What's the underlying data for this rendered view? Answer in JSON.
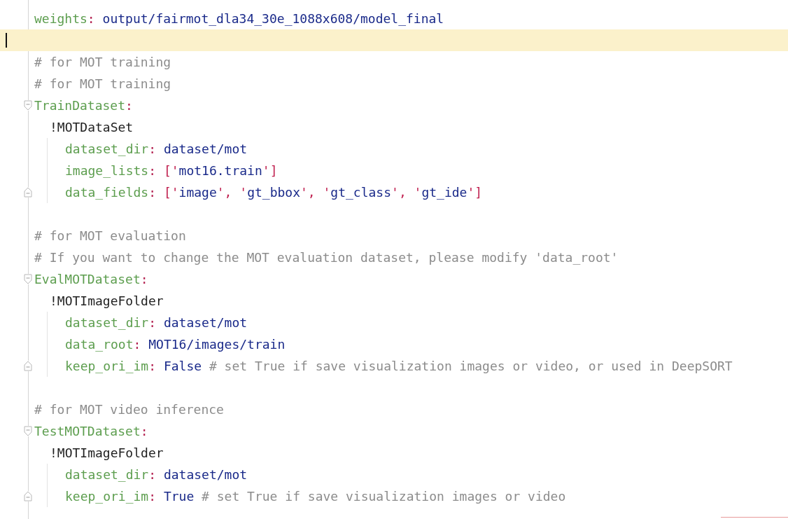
{
  "editor": {
    "sections": [
      {
        "lines": [
          {
            "segments": [
              {
                "kind": "key",
                "text": "weights"
              },
              {
                "kind": "colon",
                "text": ":"
              },
              {
                "kind": "value",
                "text": " output/fairmot_dla34_30e_1088x608/model_final"
              }
            ]
          },
          {
            "current": true
          },
          {
            "segments": [
              {
                "kind": "comment",
                "text": "# for MOT training"
              }
            ]
          },
          {
            "segments": [
              {
                "kind": "comment",
                "text": "# for MOT training"
              }
            ]
          },
          {
            "fold_start": true,
            "segments": [
              {
                "kind": "key",
                "text": "TrainDataset"
              },
              {
                "kind": "colon",
                "text": ":"
              }
            ],
            "children": [
              {
                "segments": [
                  {
                    "kind": "tag",
                    "text": "!MOTDataSet"
                  }
                ],
                "children": [
                  {
                    "segments": [
                      {
                        "kind": "key",
                        "text": "dataset_dir"
                      },
                      {
                        "kind": "colon",
                        "text": ":"
                      },
                      {
                        "kind": "value",
                        "text": " dataset/mot"
                      }
                    ]
                  },
                  {
                    "segments": [
                      {
                        "kind": "key",
                        "text": "image_lists"
                      },
                      {
                        "kind": "colon",
                        "text": ":"
                      },
                      {
                        "kind": "punct",
                        "text": " ['"
                      },
                      {
                        "kind": "value",
                        "text": "mot16.train"
                      },
                      {
                        "kind": "punct",
                        "text": "']"
                      }
                    ]
                  },
                  {
                    "fold_end": true,
                    "segments": [
                      {
                        "kind": "key",
                        "text": "data_fields"
                      },
                      {
                        "kind": "colon",
                        "text": ":"
                      },
                      {
                        "kind": "punct",
                        "text": " ['"
                      },
                      {
                        "kind": "value",
                        "text": "image"
                      },
                      {
                        "kind": "punct",
                        "text": "', '"
                      },
                      {
                        "kind": "value",
                        "text": "gt_bbox"
                      },
                      {
                        "kind": "punct",
                        "text": "', '"
                      },
                      {
                        "kind": "value",
                        "text": "gt_class"
                      },
                      {
                        "kind": "punct",
                        "text": "', '"
                      },
                      {
                        "kind": "value",
                        "text": "gt_ide"
                      },
                      {
                        "kind": "punct",
                        "text": "']"
                      }
                    ]
                  }
                ]
              }
            ]
          }
        ]
      },
      {
        "lines": [
          {
            "segments": [
              {
                "kind": "comment",
                "text": "# for MOT evaluation"
              }
            ]
          },
          {
            "segments": [
              {
                "kind": "comment",
                "text": "# If you want to change the MOT evaluation dataset, please modify 'data_root'"
              }
            ]
          },
          {
            "fold_start": true,
            "segments": [
              {
                "kind": "key",
                "text": "EvalMOTDataset"
              },
              {
                "kind": "colon",
                "text": ":"
              }
            ],
            "children": [
              {
                "segments": [
                  {
                    "kind": "tag",
                    "text": "!MOTImageFolder"
                  }
                ],
                "children": [
                  {
                    "segments": [
                      {
                        "kind": "key",
                        "text": "dataset_dir"
                      },
                      {
                        "kind": "colon",
                        "text": ":"
                      },
                      {
                        "kind": "value",
                        "text": " dataset/mot"
                      }
                    ]
                  },
                  {
                    "segments": [
                      {
                        "kind": "key",
                        "text": "data_root"
                      },
                      {
                        "kind": "colon",
                        "text": ":"
                      },
                      {
                        "kind": "value",
                        "text": " MOT16/images/train"
                      }
                    ]
                  },
                  {
                    "fold_end": true,
                    "segments": [
                      {
                        "kind": "key",
                        "text": "keep_ori_im"
                      },
                      {
                        "kind": "colon",
                        "text": ":"
                      },
                      {
                        "kind": "value",
                        "text": " False"
                      },
                      {
                        "kind": "comment",
                        "text": " # set True if save visualization images or video, or used in DeepSORT"
                      }
                    ]
                  }
                ]
              }
            ]
          }
        ]
      },
      {
        "lines": [
          {
            "segments": [
              {
                "kind": "comment",
                "text": "# for MOT video inference"
              }
            ]
          },
          {
            "fold_start": true,
            "segments": [
              {
                "kind": "key",
                "text": "TestMOTDataset"
              },
              {
                "kind": "colon",
                "text": ":"
              }
            ],
            "children": [
              {
                "segments": [
                  {
                    "kind": "tag",
                    "text": "!MOTImageFolder"
                  }
                ],
                "children": [
                  {
                    "segments": [
                      {
                        "kind": "key",
                        "text": "dataset_dir"
                      },
                      {
                        "kind": "colon",
                        "text": ":"
                      },
                      {
                        "kind": "value",
                        "text": " dataset/mot"
                      }
                    ]
                  },
                  {
                    "fold_end": true,
                    "segments": [
                      {
                        "kind": "key",
                        "text": "keep_ori_im"
                      },
                      {
                        "kind": "colon",
                        "text": ":"
                      },
                      {
                        "kind": "value",
                        "text": " True"
                      },
                      {
                        "kind": "comment",
                        "text": " # set True if save visualization images or video"
                      }
                    ]
                  }
                ]
              }
            ]
          }
        ]
      }
    ]
  }
}
